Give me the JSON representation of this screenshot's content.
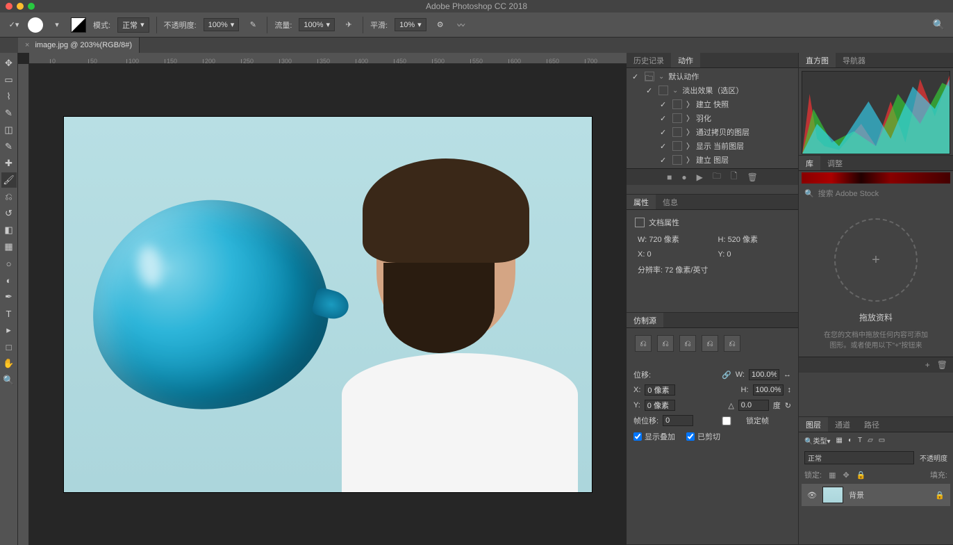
{
  "app_title": "Adobe Photoshop CC 2018",
  "options_bar": {
    "mode_label": "模式:",
    "mode_value": "正常",
    "opacity_label": "不透明度:",
    "opacity_value": "100%",
    "flow_label": "流量:",
    "flow_value": "100%",
    "smoothing_label": "平滑:",
    "smoothing_value": "10%"
  },
  "doc_tab": {
    "name": "image.jpg @ 203%(RGB/8#)",
    "close": "×"
  },
  "ruler_ticks": [
    "0",
    "50",
    "100",
    "150",
    "200",
    "250",
    "300",
    "350",
    "400",
    "450",
    "500",
    "550",
    "600",
    "650",
    "700"
  ],
  "panels": {
    "history": {
      "tab1": "历史记录",
      "tab2": "动作",
      "items": [
        {
          "label": "默认动作",
          "chev": true,
          "folder": true
        },
        {
          "label": "淡出效果（选区）",
          "chev": true,
          "indent": 1
        },
        {
          "label": "建立 快照",
          "indent": 2
        },
        {
          "label": "羽化",
          "indent": 2
        },
        {
          "label": "通过拷贝的图层",
          "indent": 2
        },
        {
          "label": "显示 当前图层",
          "indent": 2
        },
        {
          "label": "建立 图层",
          "indent": 2
        }
      ]
    },
    "properties": {
      "tab1": "属性",
      "tab2": "信息",
      "doc_props": "文档属性",
      "w_label": "W:",
      "w_val": "720 像素",
      "h_label": "H:",
      "h_val": "520 像素",
      "x_label": "X:",
      "x_val": "0",
      "y_label": "Y:",
      "y_val": "0",
      "res_label": "分辨率:",
      "res_val": "72 像素/英寸"
    },
    "clone": {
      "tab": "仿制源",
      "offset_label": "位移:",
      "w_label": "W:",
      "w_val": "100.0%",
      "h_label": "H:",
      "h_val": "100.0%",
      "x_label": "X:",
      "x_val": "0 像素",
      "y_label": "Y:",
      "y_val": "0 像素",
      "angle_val": "0.0",
      "angle_unit": "度",
      "frame_label": "帧位移:",
      "frame_val": "0",
      "lock_frame": "锁定帧",
      "show_overlay": "显示叠加",
      "clipped": "已剪切"
    },
    "histogram": {
      "tab1": "直方图",
      "tab2": "导航器"
    },
    "libraries": {
      "tab1": "库",
      "tab2": "调整",
      "search_placeholder": "搜索 Adobe Stock",
      "dropzone_title": "拖放资料",
      "dropzone_desc1": "在您的文档中拖放任何内容可添加",
      "dropzone_desc2": "图形。或者使用以下\"+\"按钮来",
      "plus": "+"
    },
    "layers": {
      "tab1": "图层",
      "tab2": "通道",
      "tab3": "路径",
      "kind_label": "类型",
      "blend_mode": "正常",
      "opacity_label": "不透明度",
      "lock_label": "锁定:",
      "fill_label": "填充:",
      "layer_name": "背景"
    }
  }
}
